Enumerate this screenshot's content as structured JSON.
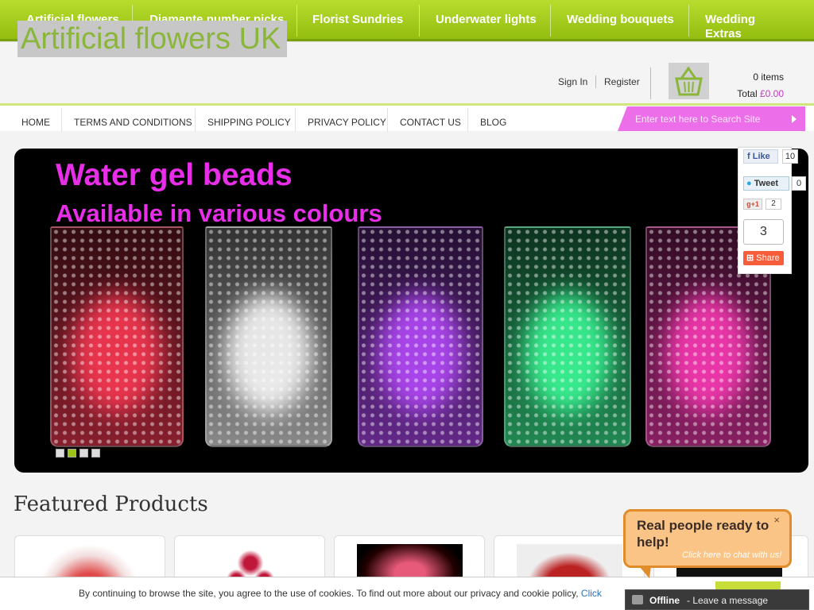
{
  "category_nav": [
    {
      "label": "Artificial flowers"
    },
    {
      "label": "Diamante number picks"
    },
    {
      "label": "Florist Sundries"
    },
    {
      "label": "Underwater lights"
    },
    {
      "label": "Wedding bouquets"
    },
    {
      "label": "Wedding Extras"
    }
  ],
  "header": {
    "logo_text": "Artificial flowers UK",
    "sign_in": "Sign In",
    "register": "Register",
    "cart_items": "0 items",
    "cart_total_label": "Total",
    "cart_total_value": "£0.00"
  },
  "page_menu": [
    {
      "label": "HOME"
    },
    {
      "label": "TERMS AND CONDITIONS"
    },
    {
      "label": "SHIPPING POLICY"
    },
    {
      "label": "PRIVACY POLICY"
    },
    {
      "label": "CONTACT US"
    },
    {
      "label": "BLOG"
    }
  ],
  "search": {
    "placeholder": "Enter text here to Search Site"
  },
  "banner": {
    "headline": "Water gel beads",
    "subheadline": "Available in various colours",
    "vase_colors": [
      "#ff3a55",
      "#ffffff",
      "#b84bff",
      "#3dff9a",
      "#ff3bb8"
    ],
    "active_slide": 2,
    "slide_count": 4
  },
  "social": {
    "like_label": "Like",
    "like_count": "10",
    "tweet_label": "Tweet",
    "tweet_count": "0",
    "gplus_label": "+1",
    "gplus_count": "2",
    "share_count": "3",
    "share_label": "Share"
  },
  "featured": {
    "title": "Featured Products"
  },
  "cookie": {
    "text": "By continuing to browse the site, you agree to the use of cookies. To find out more about our privacy and cookie policy, ",
    "link": "Click"
  },
  "chat": {
    "title": "Real people ready to help!",
    "subtitle": "Click here to chat with us!",
    "close": "×",
    "status": "Offline",
    "message": "- Leave a message"
  },
  "colors": {
    "nav_green": "#9bc319",
    "accent_pink": "#ec6ee8",
    "headline_magenta": "#e82ee8",
    "chat_orange": "#fbc487"
  }
}
